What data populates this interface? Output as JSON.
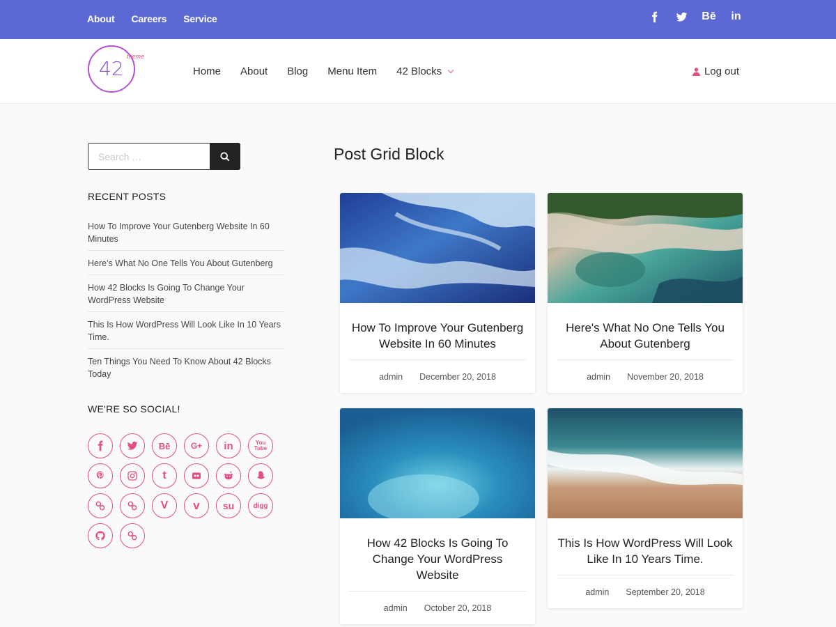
{
  "topbar": {
    "links": [
      "About",
      "Careers",
      "Service"
    ],
    "social_icons": [
      "facebook-icon",
      "twitter-icon",
      "behance-icon",
      "linkedin-icon"
    ],
    "behance_label": "Bē",
    "linkedin_label": "in",
    "bg_color": "#5c69d4"
  },
  "header": {
    "logo_number": "42",
    "logo_sub": "theme",
    "nav": [
      "Home",
      "About",
      "Blog",
      "Menu Item",
      "42 Blocks"
    ],
    "logout_label": "Log out",
    "accent_color": "#e04f86"
  },
  "sidebar": {
    "search_placeholder": "Search …",
    "recent_title": "RECENT POSTS",
    "recent_posts": [
      "How To Improve Your Gutenberg Website In 60 Minutes",
      "Here's What No One Tells You About Gutenberg",
      "How 42 Blocks Is Going To Change Your WordPress Website",
      "This Is How WordPress Will Look Like In 10 Years Time.",
      "Ten Things You Need To Know About 42 Blocks Today"
    ],
    "social_title": "WE'RE SO SOCIAL!",
    "social_icons": [
      "facebook-icon",
      "twitter-icon",
      "behance-icon",
      "google-plus-icon",
      "linkedin-icon",
      "youtube-icon",
      "pinterest-icon",
      "instagram-icon",
      "tumblr-icon",
      "flickr-icon",
      "reddit-icon",
      "snapchat-icon",
      "link-icon",
      "link-icon",
      "vine-icon",
      "vimeo-icon",
      "stumbleupon-icon",
      "digg-icon",
      "github-icon",
      "link-icon"
    ],
    "social_labels": {
      "behance": "Bē",
      "google_plus": "G+",
      "linkedin": "in",
      "youtube_top": "You",
      "youtube_bottom": "Tube",
      "tumblr": "t",
      "vine": "V",
      "vimeo": "v",
      "stumbleupon": "su",
      "digg": "digg"
    }
  },
  "main": {
    "title": "Post Grid Block",
    "posts": [
      {
        "title": "How To Improve Your Gutenberg Website In 60 Minutes",
        "author": "admin",
        "date": "December 20, 2018"
      },
      {
        "title": "Here's What No One Tells You About Gutenberg",
        "author": "admin",
        "date": "November 20, 2018"
      },
      {
        "title": "How 42 Blocks Is Going To Change Your WordPress Website",
        "author": "admin",
        "date": "October 20, 2018"
      },
      {
        "title": "This Is How WordPress Will Look Like In 10 Years Time.",
        "author": "admin",
        "date": "September 20, 2018"
      }
    ]
  }
}
